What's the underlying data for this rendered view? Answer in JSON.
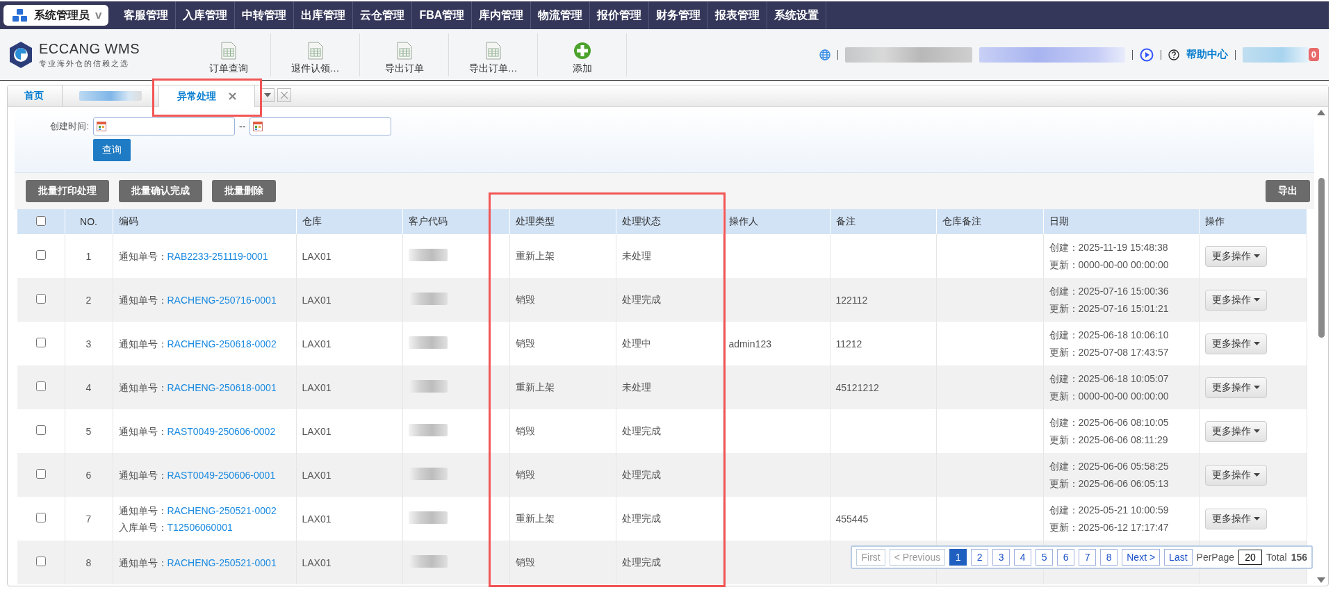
{
  "top_nav": {
    "user_menu": {
      "label": "系统管理员",
      "caret": "v"
    },
    "items": [
      {
        "label": "客服管理"
      },
      {
        "label": "入库管理"
      },
      {
        "label": "中转管理"
      },
      {
        "label": "出库管理"
      },
      {
        "label": "云仓管理"
      },
      {
        "label": "FBA管理"
      },
      {
        "label": "库内管理"
      },
      {
        "label": "物流管理"
      },
      {
        "label": "报价管理"
      },
      {
        "label": "财务管理"
      },
      {
        "label": "报表管理"
      },
      {
        "label": "系统设置"
      }
    ]
  },
  "toolbar": {
    "logo": {
      "name": "ECCANG WMS",
      "slogan": "专业海外仓的信赖之选"
    },
    "buttons": [
      {
        "label": "订单查询",
        "kind": "document"
      },
      {
        "label": "退件认领…",
        "kind": "document"
      },
      {
        "label": "导出订单",
        "kind": "document"
      },
      {
        "label": "导出订单…",
        "kind": "document"
      },
      {
        "label": "添加",
        "kind": "add"
      }
    ],
    "help_link": "帮助中心",
    "notification_count": "0"
  },
  "tabs": [
    {
      "label": "首页",
      "selected": false
    },
    {
      "kind": "redacted",
      "selected": false
    },
    {
      "label": "异常处理",
      "selected": true,
      "closable": true,
      "annotation_frame": true
    }
  ],
  "filter": {
    "label": "创建时间:",
    "range_separator": "--",
    "search_button": "查询"
  },
  "bulk_actions": [
    "批量打印处理",
    "批量确认完成",
    "批量删除"
  ],
  "export_button": "导出",
  "table": {
    "select_all": {
      "checked": false
    },
    "columns": [
      {
        "label": "NO."
      },
      {
        "label": "编码"
      },
      {
        "label": "仓库"
      },
      {
        "label": "客户代码"
      },
      {
        "label": "处理类型",
        "annotation_frame": true
      },
      {
        "label": "处理状态",
        "annotation_frame": true
      },
      {
        "label": "操作人"
      },
      {
        "label": "备注"
      },
      {
        "label": "仓库备注"
      },
      {
        "label": "日期"
      },
      {
        "label": "操作"
      }
    ],
    "rows": [
      {
        "checked": false,
        "no": "1",
        "codes": [
          {
            "label": "通知单号：",
            "value": "RAB2233-251119-0001"
          }
        ],
        "warehouse": "LAX01",
        "customer_code": {
          "redacted": true
        },
        "handling_type": "重新上架",
        "status": "未处理",
        "dates": [
          {
            "label": "创建：",
            "value": "2025-11-19 15:48:38"
          },
          {
            "label": "更新：",
            "value": "0000-00-00 00:00:00"
          }
        ],
        "action": "更多操作"
      },
      {
        "checked": false,
        "no": "2",
        "codes": [
          {
            "label": "通知单号：",
            "value": "RACHENG-250716-0001"
          }
        ],
        "warehouse": "LAX01",
        "customer_code": {
          "redacted": true
        },
        "handling_type": "销毁",
        "status": "处理完成",
        "remark": "122112",
        "dates": [
          {
            "label": "创建：",
            "value": "2025-07-16 15:00:36"
          },
          {
            "label": "更新：",
            "value": "2025-07-16 15:01:21"
          }
        ],
        "action": "更多操作"
      },
      {
        "checked": false,
        "no": "3",
        "codes": [
          {
            "label": "通知单号：",
            "value": "RACHENG-250618-0002"
          }
        ],
        "warehouse": "LAX01",
        "customer_code": {
          "redacted": true
        },
        "handling_type": "销毁",
        "status": "处理中",
        "operator": "admin123",
        "remark": "11212",
        "dates": [
          {
            "label": "创建：",
            "value": "2025-06-18 10:06:10"
          },
          {
            "label": "更新：",
            "value": "2025-07-08 17:43:57"
          }
        ],
        "action": "更多操作"
      },
      {
        "checked": false,
        "no": "4",
        "codes": [
          {
            "label": "通知单号：",
            "value": "RACHENG-250618-0001"
          }
        ],
        "warehouse": "LAX01",
        "customer_code": {
          "redacted": true
        },
        "handling_type": "重新上架",
        "status": "未处理",
        "remark": "45121212",
        "dates": [
          {
            "label": "创建：",
            "value": "2025-06-18 10:05:07"
          },
          {
            "label": "更新：",
            "value": "0000-00-00 00:00:00"
          }
        ],
        "action": "更多操作"
      },
      {
        "checked": false,
        "no": "5",
        "codes": [
          {
            "label": "通知单号：",
            "value": "RAST0049-250606-0002"
          }
        ],
        "warehouse": "LAX01",
        "customer_code": {
          "redacted": true
        },
        "handling_type": "销毁",
        "status": "处理完成",
        "dates": [
          {
            "label": "创建：",
            "value": "2025-06-06 08:10:05"
          },
          {
            "label": "更新：",
            "value": "2025-06-06 08:11:29"
          }
        ],
        "action": "更多操作"
      },
      {
        "checked": false,
        "no": "6",
        "codes": [
          {
            "label": "通知单号：",
            "value": "RAST0049-250606-0001"
          }
        ],
        "warehouse": "LAX01",
        "customer_code": {
          "redacted": true
        },
        "handling_type": "销毁",
        "status": "处理完成",
        "dates": [
          {
            "label": "创建：",
            "value": "2025-06-06 05:58:25"
          },
          {
            "label": "更新：",
            "value": "2025-06-06 06:05:13"
          }
        ],
        "action": "更多操作"
      },
      {
        "checked": false,
        "no": "7",
        "codes": [
          {
            "label": "通知单号：",
            "value": "RACHENG-250521-0002"
          },
          {
            "label": "入库单号：",
            "value": "T12506060001"
          }
        ],
        "warehouse": "LAX01",
        "customer_code": {
          "redacted": true
        },
        "handling_type": "重新上架",
        "status": "处理完成",
        "remark": "455445",
        "dates": [
          {
            "label": "创建：",
            "value": "2025-05-21 10:00:59"
          },
          {
            "label": "更新：",
            "value": "2025-06-12 17:17:47"
          }
        ],
        "action": "更多操作"
      },
      {
        "checked": false,
        "no": "8",
        "codes": [
          {
            "label": "通知单号：",
            "value": "RACHENG-250521-0001"
          }
        ],
        "warehouse": "LAX01",
        "customer_code": {
          "redacted": true
        },
        "handling_type": "销毁",
        "status": "处理完成"
      }
    ]
  },
  "pagination": {
    "first": {
      "label": "First",
      "disabled": true
    },
    "previous": {
      "label": "< Previous",
      "disabled": true
    },
    "pages": [
      {
        "label": "1",
        "selected": true
      },
      {
        "label": "2",
        "selected": false
      },
      {
        "label": "3",
        "selected": false
      },
      {
        "label": "4",
        "selected": false
      },
      {
        "label": "5",
        "selected": false
      },
      {
        "label": "6",
        "selected": false
      },
      {
        "label": "7",
        "selected": false
      },
      {
        "label": "8",
        "selected": false
      }
    ],
    "next": {
      "label": "Next >",
      "disabled": false
    },
    "last": {
      "label": "Last",
      "disabled": false
    },
    "per_page_label": "PerPage",
    "per_page": "20",
    "total_label": "Total",
    "total": "156"
  }
}
